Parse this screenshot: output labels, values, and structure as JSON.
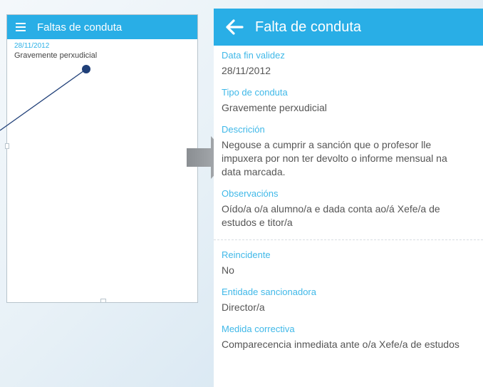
{
  "left_screen": {
    "title": "Faltas de conduta",
    "item": {
      "date": "28/11/2012",
      "type": "Gravemente perxudicial"
    }
  },
  "right_screen": {
    "title": "Falta de conduta",
    "fields": [
      {
        "label": "Data fin validez",
        "value": "28/11/2012"
      },
      {
        "label": "Tipo de conduta",
        "value": "Gravemente perxudicial"
      },
      {
        "label": "Descrición",
        "value": "Negouse a cumprir a sanción que o profesor lle impuxera por non ter devolto o informe mensual na data marcada."
      },
      {
        "label": "Observacións",
        "value": "Oído/a o/a alumno/a e dada conta ao/á Xefe/a de estudos e titor/a"
      }
    ],
    "fields_after_divider": [
      {
        "label": "Reincidente",
        "value": "No"
      },
      {
        "label": "Entidade sancionadora",
        "value": "Director/a"
      },
      {
        "label": "Medida correctiva",
        "value": "Comparecencia inmediata ante o/a Xefe/a de estudos"
      }
    ]
  },
  "colors": {
    "accent": "#29aee6",
    "label": "#3fb8e8",
    "connector": "#1f3f78"
  },
  "icons": {
    "menu": "hamburger-icon",
    "back": "back-arrow-icon",
    "flow": "arrow-right-icon"
  }
}
